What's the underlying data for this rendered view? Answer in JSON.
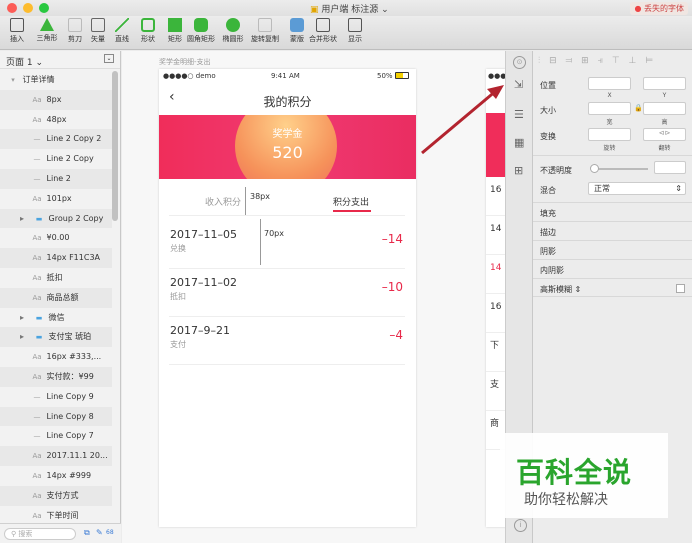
{
  "window": {
    "title": "用户端 标注源",
    "warning": "丢失的字体"
  },
  "toolbar": {
    "items": [
      {
        "label": "插入",
        "icon": "plus-icon"
      },
      {
        "label": "三角形",
        "icon": "triangle-icon"
      },
      {
        "label": "剪刀",
        "icon": "scissors-icon"
      },
      {
        "label": "矢量",
        "icon": "pen-icon"
      },
      {
        "label": "直线",
        "icon": "line-icon"
      },
      {
        "label": "形状",
        "icon": "shape-icon"
      },
      {
        "label": "矩形",
        "icon": "rect-icon"
      },
      {
        "label": "圆角矩形",
        "icon": "round-rect-icon"
      },
      {
        "label": "椭圆形",
        "icon": "oval-icon"
      },
      {
        "label": "旋转复制",
        "icon": "rotate-copy-icon"
      },
      {
        "label": "蒙版",
        "icon": "mask-icon"
      },
      {
        "label": "合并形状",
        "icon": "combine-icon"
      },
      {
        "label": "显示",
        "icon": "view-icon"
      }
    ]
  },
  "sidebar": {
    "page": "页面 1",
    "search_placeholder": "搜索",
    "count": "68",
    "layers": [
      {
        "label": "订单详情",
        "type": "group-open"
      },
      {
        "label": "8px",
        "type": "text"
      },
      {
        "label": "48px",
        "type": "text"
      },
      {
        "label": "Line 2 Copy 2",
        "type": "line"
      },
      {
        "label": "Line 2 Copy",
        "type": "line"
      },
      {
        "label": "Line 2",
        "type": "line"
      },
      {
        "label": "101px",
        "type": "text"
      },
      {
        "label": "Group 2 Copy",
        "type": "folder"
      },
      {
        "label": "¥0.00",
        "type": "text"
      },
      {
        "label": "14px F11C3A",
        "type": "text"
      },
      {
        "label": "抵扣",
        "type": "text"
      },
      {
        "label": "商品总额",
        "type": "text"
      },
      {
        "label": "微信",
        "type": "folder"
      },
      {
        "label": "支付宝 琥珀",
        "type": "folder"
      },
      {
        "label": "16px #333,...",
        "type": "text"
      },
      {
        "label": "实付款：¥99",
        "type": "text"
      },
      {
        "label": "Line Copy 9",
        "type": "line"
      },
      {
        "label": "Line Copy 8",
        "type": "line"
      },
      {
        "label": "Line Copy 7",
        "type": "line"
      },
      {
        "label": "2017.11.1 20...",
        "type": "text"
      },
      {
        "label": "14px #999",
        "type": "text"
      },
      {
        "label": "支付方式",
        "type": "text"
      },
      {
        "label": "下单时间",
        "type": "text"
      }
    ]
  },
  "canvas": {
    "artboard_label": "奖学金明细-支出"
  },
  "phone": {
    "carrier": "●●●●○ demo",
    "time": "9:41 AM",
    "battery": "50%",
    "nav_title": "我的积分",
    "banner_label": "奖学金",
    "banner_value": "520",
    "tab_income": "收入积分",
    "tab_expense": "积分支出",
    "measure_38": "38px",
    "measure_70": "70px",
    "records": [
      {
        "date": "2017–11–05",
        "desc": "兑换",
        "amount": "–14"
      },
      {
        "date": "2017–11–02",
        "desc": "抵扣",
        "amount": "–10"
      },
      {
        "date": "2017–9–21",
        "desc": "支付",
        "amount": "–4"
      }
    ]
  },
  "art2": {
    "rows": [
      "16",
      "14",
      "14",
      "16",
      "下",
      "支",
      "商"
    ]
  },
  "inspector": {
    "position": "位置",
    "x": "X",
    "y": "Y",
    "size": "大小",
    "w": "宽",
    "h": "高",
    "transform": "变换",
    "rotate": "旋转",
    "flip": "翻转",
    "opacity": "不透明度",
    "blend": "混合",
    "blend_value": "正常",
    "fill": "填充",
    "border": "描边",
    "shadow": "阴影",
    "inner_shadow": "内阴影",
    "blur": "高斯模糊"
  },
  "watermark": {
    "title": "百科全说",
    "subtitle": "助你轻松解决"
  },
  "colors": {
    "accent": "#e8294a",
    "arrow": "#b3242f"
  }
}
